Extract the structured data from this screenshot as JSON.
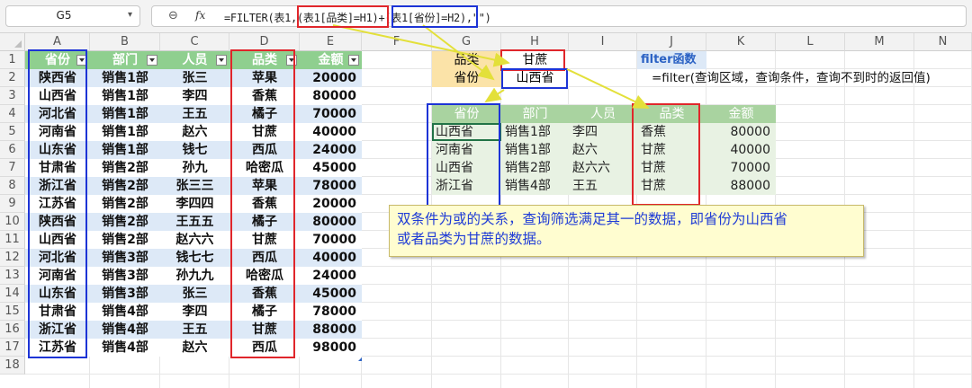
{
  "namebox": {
    "cell": "G5"
  },
  "formula_bar": {
    "fx": "fx",
    "formula": "=FILTER(表1,(表1[品类]=H1)+(表1[省份]=H2),\"\")"
  },
  "columns": [
    "A",
    "B",
    "C",
    "D",
    "E",
    "F",
    "G",
    "H",
    "I",
    "J",
    "K",
    "L",
    "M",
    "N"
  ],
  "rows": [
    "1",
    "2",
    "3",
    "4",
    "5",
    "6",
    "7",
    "8",
    "9",
    "10",
    "11",
    "12",
    "13",
    "14",
    "15",
    "16",
    "17",
    "18"
  ],
  "source_table": {
    "headers": [
      "省份",
      "部门",
      "人员",
      "品类",
      "金额"
    ],
    "rows": [
      [
        "陕西省",
        "销售1部",
        "张三",
        "苹果",
        "20000"
      ],
      [
        "山西省",
        "销售1部",
        "李四",
        "香蕉",
        "80000"
      ],
      [
        "河北省",
        "销售1部",
        "王五",
        "橘子",
        "70000"
      ],
      [
        "河南省",
        "销售1部",
        "赵六",
        "甘蔗",
        "40000"
      ],
      [
        "山东省",
        "销售1部",
        "钱七",
        "西瓜",
        "24000"
      ],
      [
        "甘肃省",
        "销售2部",
        "孙九",
        "哈密瓜",
        "45000"
      ],
      [
        "浙江省",
        "销售2部",
        "张三三",
        "苹果",
        "78000"
      ],
      [
        "江苏省",
        "销售2部",
        "李四四",
        "香蕉",
        "20000"
      ],
      [
        "陕西省",
        "销售2部",
        "王五五",
        "橘子",
        "80000"
      ],
      [
        "山西省",
        "销售2部",
        "赵六六",
        "甘蔗",
        "70000"
      ],
      [
        "河北省",
        "销售3部",
        "钱七七",
        "西瓜",
        "40000"
      ],
      [
        "河南省",
        "销售3部",
        "孙九九",
        "哈密瓜",
        "24000"
      ],
      [
        "山东省",
        "销售3部",
        "张三",
        "香蕉",
        "45000"
      ],
      [
        "甘肃省",
        "销售4部",
        "李四",
        "橘子",
        "78000"
      ],
      [
        "浙江省",
        "销售4部",
        "王五",
        "甘蔗",
        "88000"
      ],
      [
        "江苏省",
        "销售4部",
        "赵六",
        "西瓜",
        "98000"
      ]
    ]
  },
  "criteria": {
    "label1": "品类",
    "value1": "甘蔗",
    "label2": "省份",
    "value2": "山西省",
    "func_title": "filter函数",
    "syntax": "=filter(查询区域，查询条件，查询不到时的返回值)"
  },
  "result_table": {
    "headers": [
      "省份",
      "部门",
      "人员",
      "品类",
      "金额"
    ],
    "rows": [
      [
        "山西省",
        "销售1部",
        "李四",
        "香蕉",
        "80000"
      ],
      [
        "河南省",
        "销售1部",
        "赵六",
        "甘蔗",
        "40000"
      ],
      [
        "山西省",
        "销售2部",
        "赵六六",
        "甘蔗",
        "70000"
      ],
      [
        "浙江省",
        "销售4部",
        "王五",
        "甘蔗",
        "88000"
      ]
    ]
  },
  "note": {
    "line1": "双条件为或的关系，查询筛选满足其一的数据，即省份为山西省",
    "line2": "或者品类为甘蔗的数据。"
  },
  "colors": {
    "blue_box": "#1d34d6",
    "red_box": "#e0262b",
    "arrow": "#e3e03a",
    "header_green": "#8fcf8f",
    "band_blue": "#dde9f7"
  }
}
